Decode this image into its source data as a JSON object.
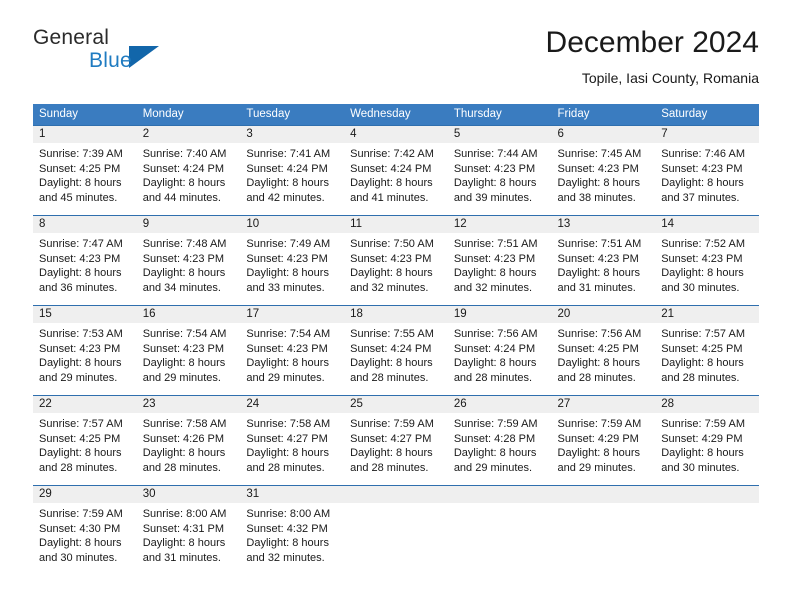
{
  "brand": {
    "name_part1": "General",
    "name_part2": "Blue",
    "logo_icon": "triangle-logo-icon"
  },
  "header": {
    "month_title": "December 2024",
    "location": "Topile, Iasi County, Romania"
  },
  "colors": {
    "header_row_bg": "#3a7cc0",
    "daynum_bg": "#efefef",
    "row_border": "#2f6fae",
    "brand_blue": "#1f7bc1",
    "text": "#1a1a1a"
  },
  "calendar": {
    "weekday_headers": [
      "Sunday",
      "Monday",
      "Tuesday",
      "Wednesday",
      "Thursday",
      "Friday",
      "Saturday"
    ],
    "weeks": [
      [
        {
          "day": "1",
          "sunrise": "Sunrise: 7:39 AM",
          "sunset": "Sunset: 4:25 PM",
          "daylight_line1": "Daylight: 8 hours",
          "daylight_line2": "and 45 minutes."
        },
        {
          "day": "2",
          "sunrise": "Sunrise: 7:40 AM",
          "sunset": "Sunset: 4:24 PM",
          "daylight_line1": "Daylight: 8 hours",
          "daylight_line2": "and 44 minutes."
        },
        {
          "day": "3",
          "sunrise": "Sunrise: 7:41 AM",
          "sunset": "Sunset: 4:24 PM",
          "daylight_line1": "Daylight: 8 hours",
          "daylight_line2": "and 42 minutes."
        },
        {
          "day": "4",
          "sunrise": "Sunrise: 7:42 AM",
          "sunset": "Sunset: 4:24 PM",
          "daylight_line1": "Daylight: 8 hours",
          "daylight_line2": "and 41 minutes."
        },
        {
          "day": "5",
          "sunrise": "Sunrise: 7:44 AM",
          "sunset": "Sunset: 4:23 PM",
          "daylight_line1": "Daylight: 8 hours",
          "daylight_line2": "and 39 minutes."
        },
        {
          "day": "6",
          "sunrise": "Sunrise: 7:45 AM",
          "sunset": "Sunset: 4:23 PM",
          "daylight_line1": "Daylight: 8 hours",
          "daylight_line2": "and 38 minutes."
        },
        {
          "day": "7",
          "sunrise": "Sunrise: 7:46 AM",
          "sunset": "Sunset: 4:23 PM",
          "daylight_line1": "Daylight: 8 hours",
          "daylight_line2": "and 37 minutes."
        }
      ],
      [
        {
          "day": "8",
          "sunrise": "Sunrise: 7:47 AM",
          "sunset": "Sunset: 4:23 PM",
          "daylight_line1": "Daylight: 8 hours",
          "daylight_line2": "and 36 minutes."
        },
        {
          "day": "9",
          "sunrise": "Sunrise: 7:48 AM",
          "sunset": "Sunset: 4:23 PM",
          "daylight_line1": "Daylight: 8 hours",
          "daylight_line2": "and 34 minutes."
        },
        {
          "day": "10",
          "sunrise": "Sunrise: 7:49 AM",
          "sunset": "Sunset: 4:23 PM",
          "daylight_line1": "Daylight: 8 hours",
          "daylight_line2": "and 33 minutes."
        },
        {
          "day": "11",
          "sunrise": "Sunrise: 7:50 AM",
          "sunset": "Sunset: 4:23 PM",
          "daylight_line1": "Daylight: 8 hours",
          "daylight_line2": "and 32 minutes."
        },
        {
          "day": "12",
          "sunrise": "Sunrise: 7:51 AM",
          "sunset": "Sunset: 4:23 PM",
          "daylight_line1": "Daylight: 8 hours",
          "daylight_line2": "and 32 minutes."
        },
        {
          "day": "13",
          "sunrise": "Sunrise: 7:51 AM",
          "sunset": "Sunset: 4:23 PM",
          "daylight_line1": "Daylight: 8 hours",
          "daylight_line2": "and 31 minutes."
        },
        {
          "day": "14",
          "sunrise": "Sunrise: 7:52 AM",
          "sunset": "Sunset: 4:23 PM",
          "daylight_line1": "Daylight: 8 hours",
          "daylight_line2": "and 30 minutes."
        }
      ],
      [
        {
          "day": "15",
          "sunrise": "Sunrise: 7:53 AM",
          "sunset": "Sunset: 4:23 PM",
          "daylight_line1": "Daylight: 8 hours",
          "daylight_line2": "and 29 minutes."
        },
        {
          "day": "16",
          "sunrise": "Sunrise: 7:54 AM",
          "sunset": "Sunset: 4:23 PM",
          "daylight_line1": "Daylight: 8 hours",
          "daylight_line2": "and 29 minutes."
        },
        {
          "day": "17",
          "sunrise": "Sunrise: 7:54 AM",
          "sunset": "Sunset: 4:23 PM",
          "daylight_line1": "Daylight: 8 hours",
          "daylight_line2": "and 29 minutes."
        },
        {
          "day": "18",
          "sunrise": "Sunrise: 7:55 AM",
          "sunset": "Sunset: 4:24 PM",
          "daylight_line1": "Daylight: 8 hours",
          "daylight_line2": "and 28 minutes."
        },
        {
          "day": "19",
          "sunrise": "Sunrise: 7:56 AM",
          "sunset": "Sunset: 4:24 PM",
          "daylight_line1": "Daylight: 8 hours",
          "daylight_line2": "and 28 minutes."
        },
        {
          "day": "20",
          "sunrise": "Sunrise: 7:56 AM",
          "sunset": "Sunset: 4:25 PM",
          "daylight_line1": "Daylight: 8 hours",
          "daylight_line2": "and 28 minutes."
        },
        {
          "day": "21",
          "sunrise": "Sunrise: 7:57 AM",
          "sunset": "Sunset: 4:25 PM",
          "daylight_line1": "Daylight: 8 hours",
          "daylight_line2": "and 28 minutes."
        }
      ],
      [
        {
          "day": "22",
          "sunrise": "Sunrise: 7:57 AM",
          "sunset": "Sunset: 4:25 PM",
          "daylight_line1": "Daylight: 8 hours",
          "daylight_line2": "and 28 minutes."
        },
        {
          "day": "23",
          "sunrise": "Sunrise: 7:58 AM",
          "sunset": "Sunset: 4:26 PM",
          "daylight_line1": "Daylight: 8 hours",
          "daylight_line2": "and 28 minutes."
        },
        {
          "day": "24",
          "sunrise": "Sunrise: 7:58 AM",
          "sunset": "Sunset: 4:27 PM",
          "daylight_line1": "Daylight: 8 hours",
          "daylight_line2": "and 28 minutes."
        },
        {
          "day": "25",
          "sunrise": "Sunrise: 7:59 AM",
          "sunset": "Sunset: 4:27 PM",
          "daylight_line1": "Daylight: 8 hours",
          "daylight_line2": "and 28 minutes."
        },
        {
          "day": "26",
          "sunrise": "Sunrise: 7:59 AM",
          "sunset": "Sunset: 4:28 PM",
          "daylight_line1": "Daylight: 8 hours",
          "daylight_line2": "and 29 minutes."
        },
        {
          "day": "27",
          "sunrise": "Sunrise: 7:59 AM",
          "sunset": "Sunset: 4:29 PM",
          "daylight_line1": "Daylight: 8 hours",
          "daylight_line2": "and 29 minutes."
        },
        {
          "day": "28",
          "sunrise": "Sunrise: 7:59 AM",
          "sunset": "Sunset: 4:29 PM",
          "daylight_line1": "Daylight: 8 hours",
          "daylight_line2": "and 30 minutes."
        }
      ],
      [
        {
          "day": "29",
          "sunrise": "Sunrise: 7:59 AM",
          "sunset": "Sunset: 4:30 PM",
          "daylight_line1": "Daylight: 8 hours",
          "daylight_line2": "and 30 minutes."
        },
        {
          "day": "30",
          "sunrise": "Sunrise: 8:00 AM",
          "sunset": "Sunset: 4:31 PM",
          "daylight_line1": "Daylight: 8 hours",
          "daylight_line2": "and 31 minutes."
        },
        {
          "day": "31",
          "sunrise": "Sunrise: 8:00 AM",
          "sunset": "Sunset: 4:32 PM",
          "daylight_line1": "Daylight: 8 hours",
          "daylight_line2": "and 32 minutes."
        },
        {
          "day": "",
          "sunrise": "",
          "sunset": "",
          "daylight_line1": "",
          "daylight_line2": ""
        },
        {
          "day": "",
          "sunrise": "",
          "sunset": "",
          "daylight_line1": "",
          "daylight_line2": ""
        },
        {
          "day": "",
          "sunrise": "",
          "sunset": "",
          "daylight_line1": "",
          "daylight_line2": ""
        },
        {
          "day": "",
          "sunrise": "",
          "sunset": "",
          "daylight_line1": "",
          "daylight_line2": ""
        }
      ]
    ]
  }
}
